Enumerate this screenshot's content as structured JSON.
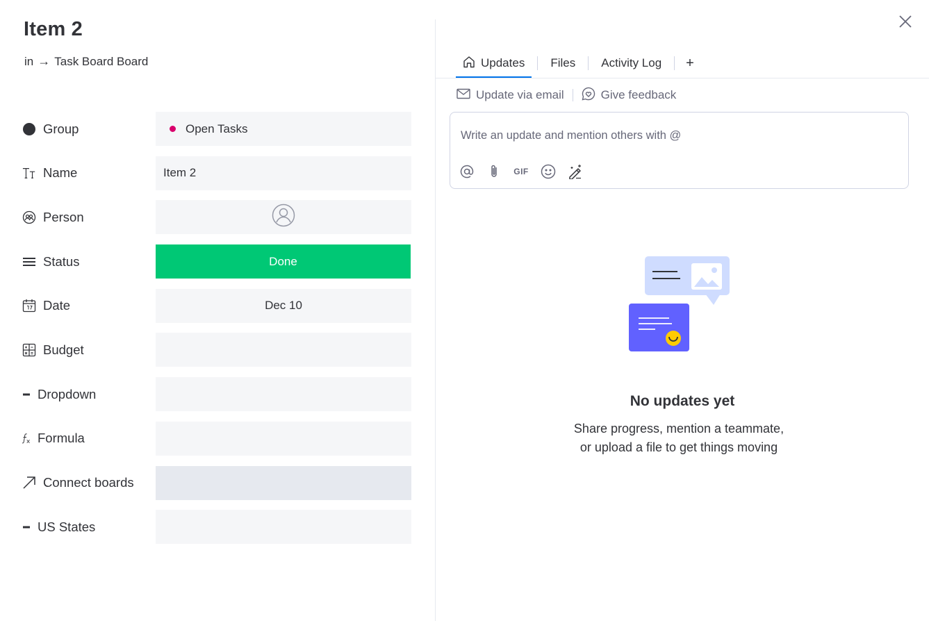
{
  "item": {
    "title": "Item 2",
    "breadcrumb_prefix": "in",
    "breadcrumb_arrow": "→",
    "board_name": "Task Board Board"
  },
  "columns": [
    {
      "label": "Group",
      "icon": "filled-circle-icon",
      "value": "Open Tasks",
      "value_color": "#d9006c"
    },
    {
      "label": "Name",
      "icon": "text-type-icon",
      "value": "Item 2"
    },
    {
      "label": "Person",
      "icon": "person-column-icon",
      "value": ""
    },
    {
      "label": "Status",
      "icon": "status-lines-icon",
      "value": "Done",
      "value_color": "#00c875"
    },
    {
      "label": "Date",
      "icon": "calendar-icon",
      "value": "Dec 10"
    },
    {
      "label": "Budget",
      "icon": "numbers-icon",
      "value": ""
    },
    {
      "label": "Dropdown",
      "icon": "dash-icon",
      "value": ""
    },
    {
      "label": "Formula",
      "icon": "formula-icon",
      "value": ""
    },
    {
      "label": "Connect boards",
      "icon": "arrow-up-right-icon",
      "value": ""
    },
    {
      "label": "US States",
      "icon": "dash-icon",
      "value": ""
    }
  ],
  "tabs": [
    {
      "label": "Updates",
      "icon": "home-icon",
      "active": true
    },
    {
      "label": "Files",
      "active": false
    },
    {
      "label": "Activity Log",
      "active": false
    },
    {
      "label": "+",
      "active": false
    }
  ],
  "actions": {
    "update_via_email": "Update via email",
    "give_feedback": "Give feedback"
  },
  "editor": {
    "placeholder": "Write an update and mention others with @",
    "gif_label": "GIF"
  },
  "empty_state": {
    "title": "No updates yet",
    "line1": "Share progress, mention a teammate,",
    "line2": "or upload a file to get things moving"
  },
  "colors": {
    "accent": "#0073ea",
    "done": "#00c875",
    "group": "#d9006c",
    "illustration_purple": "#6161ff",
    "illustration_light": "#cfdcff",
    "illustration_yellow": "#ffcb00"
  }
}
